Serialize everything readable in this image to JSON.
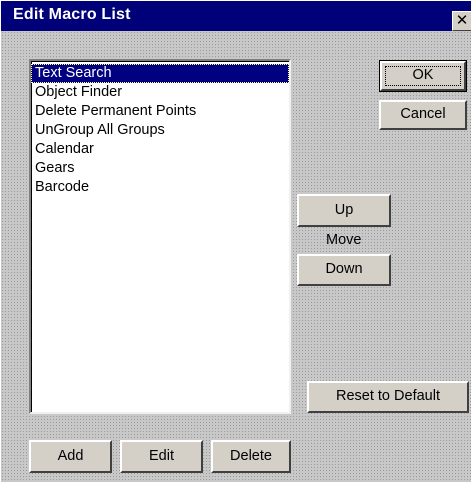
{
  "window": {
    "title": "Edit Macro List",
    "close_glyph": "✕"
  },
  "macro_list": {
    "items": [
      "Text Search",
      "Object Finder",
      "Delete Permanent Points",
      "UnGroup All Groups",
      "Calendar",
      "Gears",
      "Barcode"
    ],
    "selected_index": 0
  },
  "buttons": {
    "ok": "OK",
    "cancel": "Cancel",
    "up": "Up",
    "move_label": "Move",
    "down": "Down",
    "reset": "Reset to Default",
    "add": "Add",
    "edit": "Edit",
    "delete": "Delete"
  },
  "colors": {
    "titlebar": "#000078",
    "selection": "#000080",
    "face": "#d4d0c8"
  }
}
